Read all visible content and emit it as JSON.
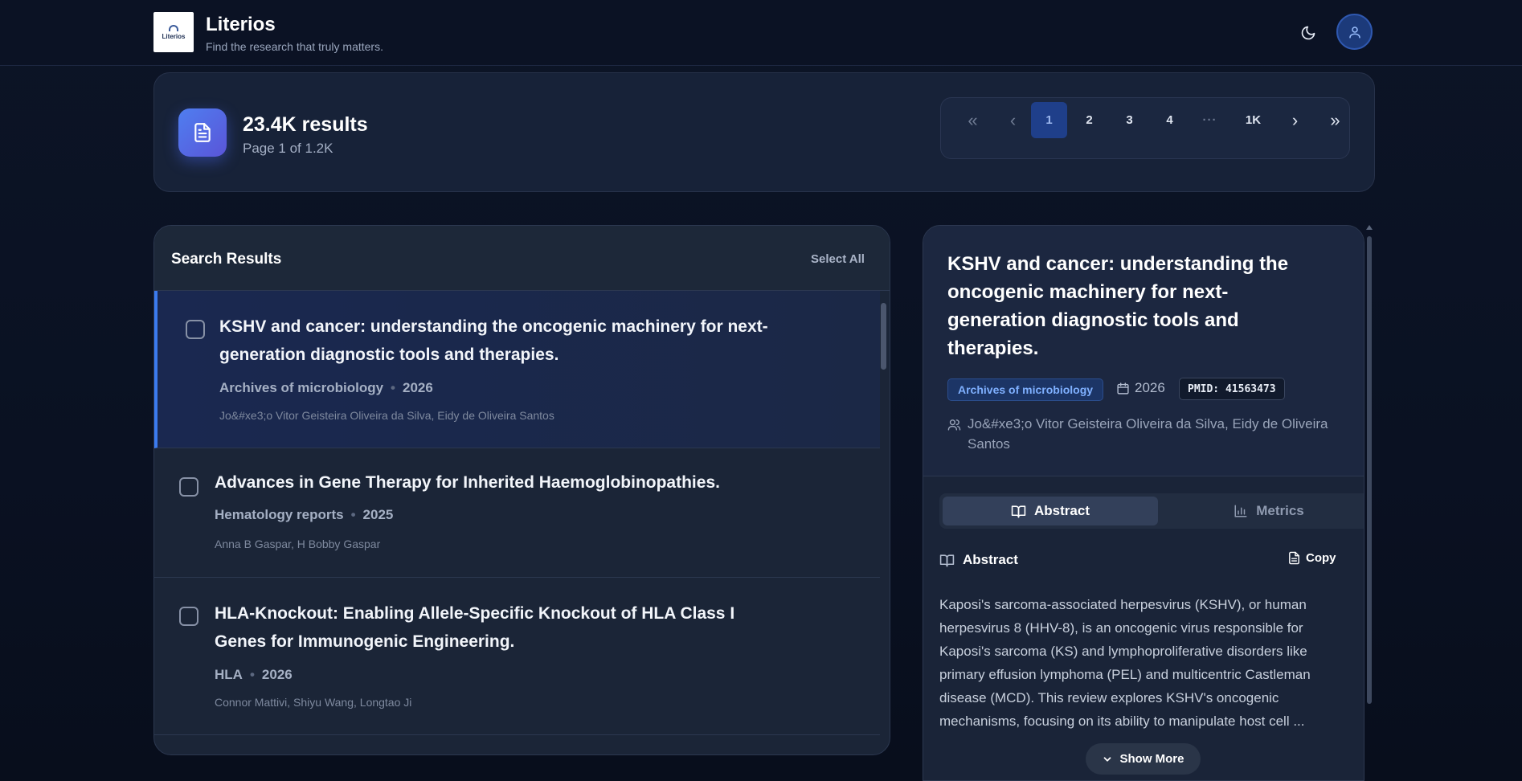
{
  "brand": {
    "logo_text": "Literios",
    "title": "Literios",
    "tagline": "Find the research that truly matters."
  },
  "summary": {
    "count": "23.4K results",
    "page_of": "Page 1 of 1.2K"
  },
  "pagination": {
    "first": "«",
    "prev": "‹",
    "pages": [
      "1",
      "2",
      "3",
      "4"
    ],
    "ellipsis": "···",
    "last_page": "1K",
    "next": "›",
    "last": "»",
    "active_page": "1"
  },
  "results": {
    "title": "Search Results",
    "select_all": "Select All",
    "items": [
      {
        "title": "KSHV and cancer: understanding the oncogenic machinery for next-generation diagnostic tools and therapies.",
        "journal": "Archives of microbiology",
        "year": "2026",
        "authors": "Jo&#xe3;o Vitor Geisteira Oliveira da Silva, Eidy de Oliveira Santos",
        "selected": true
      },
      {
        "title": "Advances in Gene Therapy for Inherited Haemoglobinopathies.",
        "journal": "Hematology reports",
        "year": "2025",
        "authors": "Anna B Gaspar, H Bobby Gaspar",
        "selected": false
      },
      {
        "title": "HLA-Knockout: Enabling Allele-Specific Knockout of HLA Class I Genes for Immunogenic Engineering.",
        "journal": "HLA",
        "year": "2026",
        "authors": "Connor Mattivi, Shiyu Wang, Longtao Ji",
        "selected": false
      }
    ]
  },
  "detail": {
    "title": "KSHV and cancer: understanding the oncogenic machinery for next-generation diagnostic tools and therapies.",
    "journal": "Archives of microbiology",
    "year": "2026",
    "pmid": "PMID: 41563473",
    "authors": "Jo&#xe3;o Vitor Geisteira Oliveira da Silva, Eidy de Oliveira Santos",
    "tabs": {
      "abstract": "Abstract",
      "metrics": "Metrics"
    },
    "abstract_heading": "Abstract",
    "copy_label": "Copy",
    "abstract_text": "Kaposi's sarcoma-associated herpesvirus (KSHV), or human herpesvirus 8 (HHV-8), is an oncogenic virus responsible for Kaposi's sarcoma (KS) and lymphoproliferative disorders like primary effusion lymphoma (PEL) and multicentric Castleman disease (MCD). This review explores KSHV's oncogenic mechanisms, focusing on its ability to manipulate host cell ...",
    "show_more": "Show More"
  },
  "icons": {
    "theme": "moon-icon",
    "user": "user-icon",
    "summary": "document-icon",
    "calendar": "calendar-icon",
    "authors": "users-icon",
    "abstract_tab": "book-open-icon",
    "metrics_tab": "bar-chart-icon",
    "copy": "clipboard-icon",
    "show_more": "chevron-down-icon"
  },
  "colors": {
    "accent": "#3b7bef",
    "active_page": "#1f3f8a",
    "badge_text": "#7fb0ff"
  }
}
